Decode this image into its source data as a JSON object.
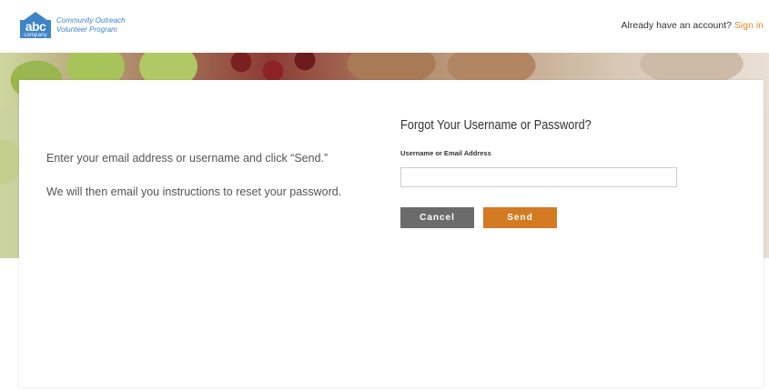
{
  "header": {
    "logo_abc": "abc",
    "logo_company": "company",
    "logo_line1": "Community Outreach",
    "logo_line2": "Volunteer Program",
    "account_prompt": "Already have an account?",
    "signin_label": "Sign in"
  },
  "main": {
    "info_line1": "Enter your email address or username and click “Send.”",
    "info_line2": "We will then email you instructions to reset your password.",
    "form_title": "Forgot Your Username or Password?",
    "field_label": "Username or Email Address",
    "field_value": "",
    "cancel_label": "Cancel",
    "send_label": "Send"
  },
  "colors": {
    "brand_blue": "#3f84c6",
    "accent_orange": "#d47a22",
    "cancel_gray": "#6b6b6b"
  }
}
